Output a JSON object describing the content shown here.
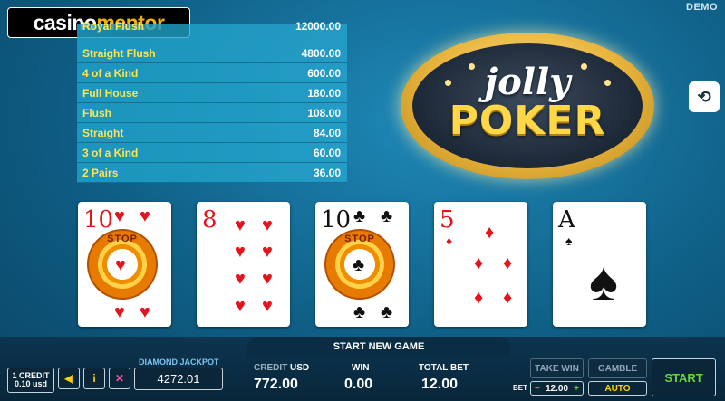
{
  "brand": {
    "part1": "casino",
    "part2": "mentor"
  },
  "demo_label": "DEMO",
  "paytable": [
    {
      "hand": "Royal Flush",
      "amount": "12000.00"
    },
    {
      "hand": "Straight Flush",
      "amount": "4800.00"
    },
    {
      "hand": "4 of a Kind",
      "amount": "600.00"
    },
    {
      "hand": "Full House",
      "amount": "180.00"
    },
    {
      "hand": "Flush",
      "amount": "108.00"
    },
    {
      "hand": "Straight",
      "amount": "84.00"
    },
    {
      "hand": "3 of a Kind",
      "amount": "60.00"
    },
    {
      "hand": "2 Pairs",
      "amount": "36.00"
    }
  ],
  "logo": {
    "line1": "jolly",
    "line2": "POKER"
  },
  "cards": [
    {
      "rank": "10",
      "suit": "♥",
      "color": "red",
      "held": true,
      "hold_text": "STOP"
    },
    {
      "rank": "8",
      "suit": "♥",
      "color": "red",
      "held": false
    },
    {
      "rank": "10",
      "suit": "♣",
      "color": "black",
      "held": true,
      "hold_text": "STOP"
    },
    {
      "rank": "5",
      "suit": "♦",
      "color": "red",
      "held": false
    },
    {
      "rank": "A",
      "suit": "♠",
      "color": "black",
      "held": false
    }
  ],
  "bottom": {
    "message": "START NEW GAME",
    "credit_line1": "1 CREDIT",
    "credit_line2": "0.10 usd",
    "jackpot_label": "DIAMOND JACKPOT",
    "jackpot_value": "4272.01",
    "credit_label": "CREDIT",
    "credit_unit": "USD",
    "credit_value": "772.00",
    "win_label": "WIN",
    "win_value": "0.00",
    "total_bet_label": "TOTAL BET",
    "total_bet_value": "12.00",
    "take_win": "TAKE WIN",
    "gamble": "GAMBLE",
    "bet_label": "BET",
    "bet_minus": "−",
    "bet_value": "12.00",
    "bet_plus": "+",
    "auto": "AUTO",
    "start": "START"
  },
  "icons": {
    "arrow": "◀",
    "info": "i",
    "fullscreen": "✕",
    "history": "⟲"
  },
  "colors": {
    "hand_text": "#ffe44c",
    "start_text": "#6bd342",
    "background": "#0f5f86"
  }
}
